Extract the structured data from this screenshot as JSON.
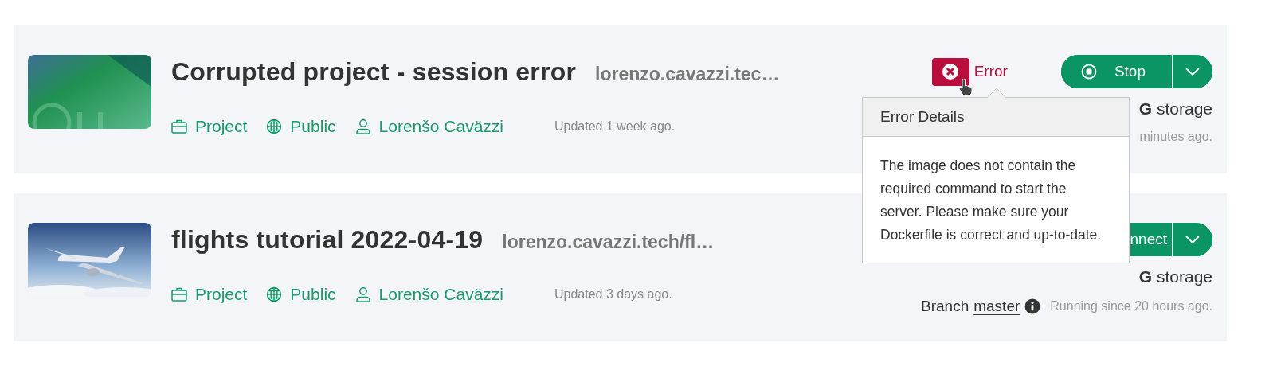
{
  "projects": [
    {
      "title": "Corrupted project - session error",
      "url": "lorenzo.cavazzi.tec…",
      "meta": [
        {
          "kind": "project",
          "label": "Project"
        },
        {
          "kind": "visibility",
          "label": "Public"
        },
        {
          "kind": "owner",
          "label": "Lorenšo Caväzzi"
        }
      ],
      "updated": "Updated 1 week ago.",
      "status": {
        "kind": "error",
        "label": "Error"
      },
      "action": {
        "kind": "stop",
        "label": "Stop"
      },
      "storage": "**G** storage",
      "session_time": "minutes ago."
    },
    {
      "title": "flights tutorial 2022-04-19",
      "url": "lorenzo.cavazzi.tech/fl…",
      "meta": [
        {
          "kind": "project",
          "label": "Project"
        },
        {
          "kind": "visibility",
          "label": "Public"
        },
        {
          "kind": "owner",
          "label": "Lorenšo Caväzzi"
        }
      ],
      "updated": "Updated 3 days ago.",
      "action": {
        "kind": "connect",
        "label": "nnect"
      },
      "storage": "**G** storage",
      "branch": {
        "label": "Branch",
        "name": "master"
      },
      "session_time": "Running since 20 hours ago."
    }
  ],
  "error_popover": {
    "title": "Error Details",
    "message": "The image does not contain the required command to start the server. Please make sure your Dockerfile is correct and up-to-date."
  }
}
